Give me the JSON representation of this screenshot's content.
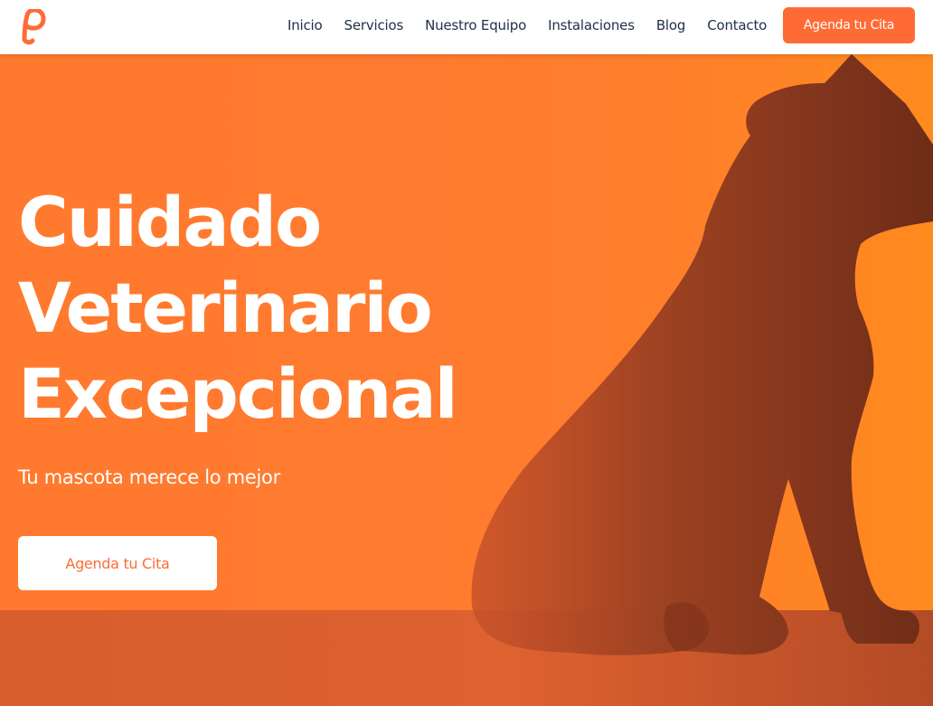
{
  "header": {
    "logo_icon": "paw-p-logo-icon",
    "nav": [
      {
        "label": "Inicio"
      },
      {
        "label": "Servicios"
      },
      {
        "label": "Nuestro Equipo"
      },
      {
        "label": "Instalaciones"
      },
      {
        "label": "Blog"
      },
      {
        "label": "Contacto"
      }
    ],
    "cta_label": "Agenda tu Cita"
  },
  "hero": {
    "title_lines": [
      "Cuidado",
      "Veterinario",
      "Excepcional"
    ],
    "subtitle": "Tu mascota merece lo mejor",
    "cta_label": "Agenda tu Cita",
    "background_image": "dog-silhouette"
  },
  "colors": {
    "brand": "#ff6b35",
    "hero_background": "#ff7a2e",
    "nav_text": "#22304a",
    "silhouette": "#7a2f1a"
  }
}
